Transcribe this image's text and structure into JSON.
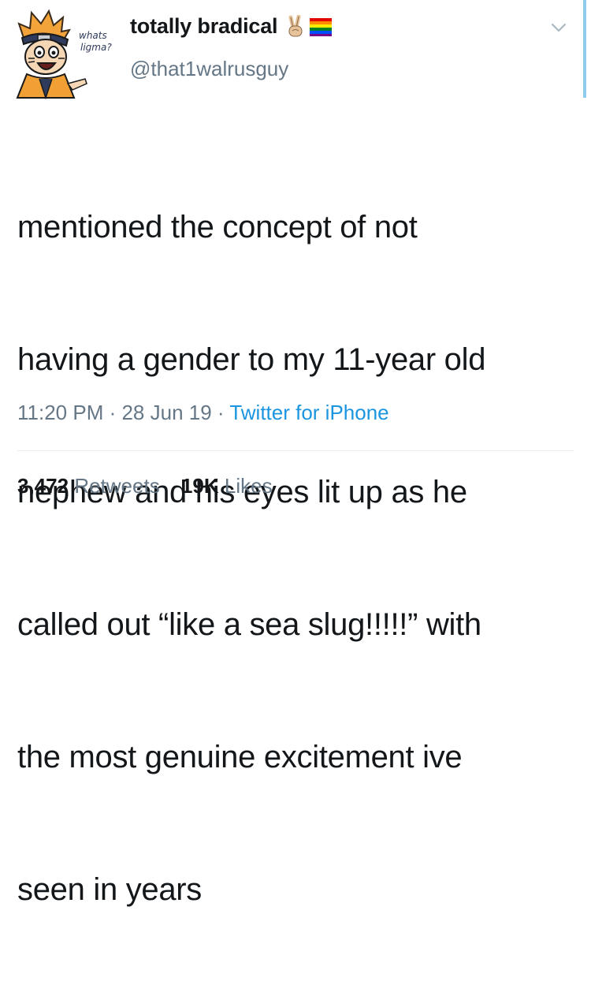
{
  "author": {
    "display_name": "totally bradical",
    "handle": "@that1walrusguy",
    "avatar_caption_line1": "whats",
    "avatar_caption_line2": "ligma?",
    "name_emojis": [
      "victory-hand-icon",
      "rainbow-flag-icon"
    ]
  },
  "tweet": {
    "text_lines": [
      "mentioned the concept of not",
      "having a gender to my 11-year old",
      "nephew and his eyes lit up as he",
      "called out “like a sea slug!!!!!” with",
      "the most genuine excitement ive",
      "seen in years"
    ],
    "time": "11:20 PM",
    "date": "28 Jun 19",
    "source": "Twitter for iPhone",
    "separator": " · "
  },
  "stats": {
    "retweets_count": "3,472",
    "retweets_label": "Retweets",
    "likes_count": "19K",
    "likes_label": "Likes"
  },
  "colors": {
    "text": "#14171a",
    "secondary": "#657786",
    "link": "#1b95e0",
    "divider": "#e6ecf0"
  }
}
